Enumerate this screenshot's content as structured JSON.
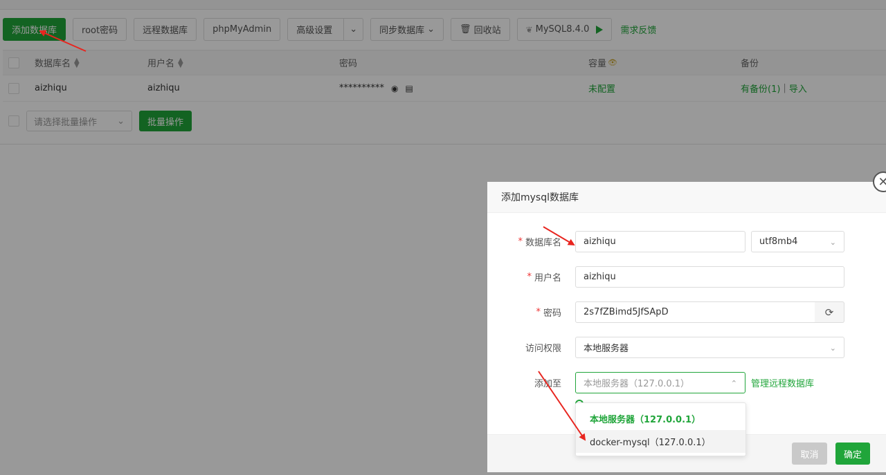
{
  "toolbar": {
    "add_db": "添加数据库",
    "root_pwd": "root密码",
    "remote_db": "远程数据库",
    "phpmyadmin": "phpMyAdmin",
    "advanced": "高级设置",
    "sync_db": "同步数据库",
    "recycle": "回收站",
    "mysql_version": "MySQL8.4.0",
    "feedback": "需求反馈"
  },
  "table": {
    "headers": {
      "db_name": "数据库名",
      "username": "用户名",
      "password": "密码",
      "capacity": "容量",
      "backup": "备份"
    },
    "rows": [
      {
        "db_name": "aizhiqu",
        "username": "aizhiqu",
        "password": "**********",
        "capacity": "未配置",
        "backup": "有备份(1)",
        "backup_sep": "|",
        "import": "导入"
      }
    ]
  },
  "bulk": {
    "select_placeholder": "请选择批量操作",
    "button": "批量操作"
  },
  "dialog": {
    "title": "添加mysql数据库",
    "db_name_label": "数据库名",
    "db_name_value": "aizhiqu",
    "charset_value": "utf8mb4",
    "username_label": "用户名",
    "username_value": "aizhiqu",
    "password_label": "密码",
    "password_value": "2s7fZBimd5JfSApD",
    "access_label": "访问权限",
    "access_value": "本地服务器",
    "add_to_label": "添加至",
    "add_to_placeholder": "本地服务器（127.0.0.1）",
    "manage_remote": "管理远程数据库",
    "cancel": "取消",
    "ok": "确定"
  },
  "dropdown": {
    "options": [
      "本地服务器（127.0.0.1）",
      "docker-mysql（127.0.0.1）"
    ]
  },
  "colors": {
    "accent": "#20a53a",
    "overlay": "rgba(0,0,0,0.4)",
    "arrow": "#e8251f"
  },
  "icons": [
    "caret-sort-icon",
    "eye-icon",
    "copy-icon",
    "trash-icon",
    "play-icon",
    "refresh-icon",
    "chevron-down-icon",
    "chevron-up-icon",
    "close-icon",
    "leaf-icon"
  ]
}
